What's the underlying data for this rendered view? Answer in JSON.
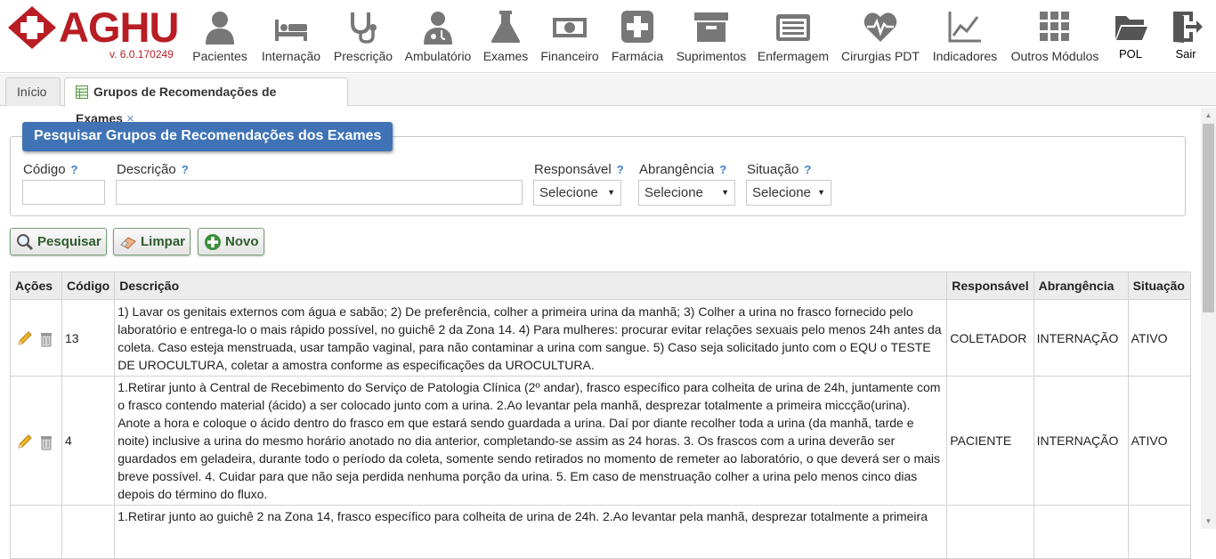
{
  "app": {
    "logo_text": "AGHU",
    "version": "v. 6.0.170249"
  },
  "menu": [
    {
      "label": "Pacientes",
      "icon": "patient-icon"
    },
    {
      "label": "Internação",
      "icon": "bed-icon"
    },
    {
      "label": "Prescrição",
      "icon": "stethoscope-icon"
    },
    {
      "label": "Ambulatório",
      "icon": "doctor-icon"
    },
    {
      "label": "Exames",
      "icon": "flask-icon"
    },
    {
      "label": "Financeiro",
      "icon": "money-icon"
    },
    {
      "label": "Farmácia",
      "icon": "pharmacy-cross-icon"
    },
    {
      "label": "Suprimentos",
      "icon": "box-icon"
    },
    {
      "label": "Enfermagem",
      "icon": "clipboard-list-icon"
    },
    {
      "label": "Cirurgias PDT",
      "icon": "heartbeat-icon"
    },
    {
      "label": "Indicadores",
      "icon": "line-chart-icon"
    },
    {
      "label": "Outros Módulos",
      "icon": "grid-icon"
    },
    {
      "label": "POL",
      "icon": "folder-icon"
    },
    {
      "label": "Sair",
      "icon": "exit-icon"
    }
  ],
  "tabs": [
    {
      "label": "Início"
    },
    {
      "label": "Grupos de Recomendações de Exames",
      "close": "×"
    }
  ],
  "search": {
    "legend": "Pesquisar Grupos de Recomendações dos Exames",
    "help": "?",
    "codigo_label": "Código",
    "descricao_label": "Descrição",
    "responsavel_label": "Responsável",
    "responsavel_value": "Selecione",
    "abrangencia_label": "Abrangência",
    "abrangencia_value": "Selecione",
    "situacao_label": "Situação",
    "situacao_value": "Selecione"
  },
  "buttons": {
    "pesquisar": "Pesquisar",
    "limpar": "Limpar",
    "novo": "Novo"
  },
  "table": {
    "headers": [
      "Ações",
      "Código",
      "Descrição",
      "Responsável",
      "Abrangência",
      "Situação"
    ],
    "rows": [
      {
        "codigo": "13",
        "descricao": "1) Lavar os genitais externos com água e sabão; 2) De preferência, colher a primeira urina da manhã; 3) Colher a urina no frasco fornecido pelo laboratório e entrega-lo o mais rápido possível, no guichê 2 da Zona 14. 4) Para mulheres: procurar evitar relações sexuais pelo menos 24h antes da coleta. Caso esteja menstruada, usar tampão vaginal, para não contaminar a urina com sangue. 5) Caso seja solicitado junto com o EQU o TESTE DE UROCULTURA, coletar a amostra conforme as especificações da UROCULTURA.",
        "responsavel": "COLETADOR",
        "abrangencia": "INTERNAÇÃO",
        "situacao": "ATIVO"
      },
      {
        "codigo": "4",
        "descricao": "1.Retirar junto à Central de Recebimento do Serviço de Patologia Clínica (2º andar), frasco específico para colheita de urina de 24h, juntamente com o frasco contendo material (ácido) a ser colocado junto com a urina. 2.Ao levantar pela manhã, desprezar totalmente a primeira miccção(urina). Anote a hora e coloque o ácido dentro do frasco em que estará sendo guardada a urina. Daí por diante recolher toda a urina (da manhã, tarde e noite) inclusive a urina do mesmo horário anotado no dia anterior, completando-se assim as 24 horas. 3. Os frascos com a urina deverão ser guardados em geladeira, durante todo o período da coleta, somente sendo retirados no momento de remeter ao laboratório, o que deverá ser o mais breve possível. 4. Cuidar para que não seja perdida nenhuma porção da urina. 5. Em caso de menstruação colher a urina pelo menos cinco dias depois do término do fluxo.",
        "responsavel": "PACIENTE",
        "abrangencia": "INTERNAÇÃO",
        "situacao": "ATIVO"
      },
      {
        "codigo": "",
        "descricao": "1.Retirar junto ao guichê 2 na Zona 14, frasco específico para colheita de urina de 24h. 2.Ao levantar pela manhã, desprezar totalmente a primeira",
        "responsavel": "",
        "abrangencia": "",
        "situacao": ""
      }
    ]
  }
}
